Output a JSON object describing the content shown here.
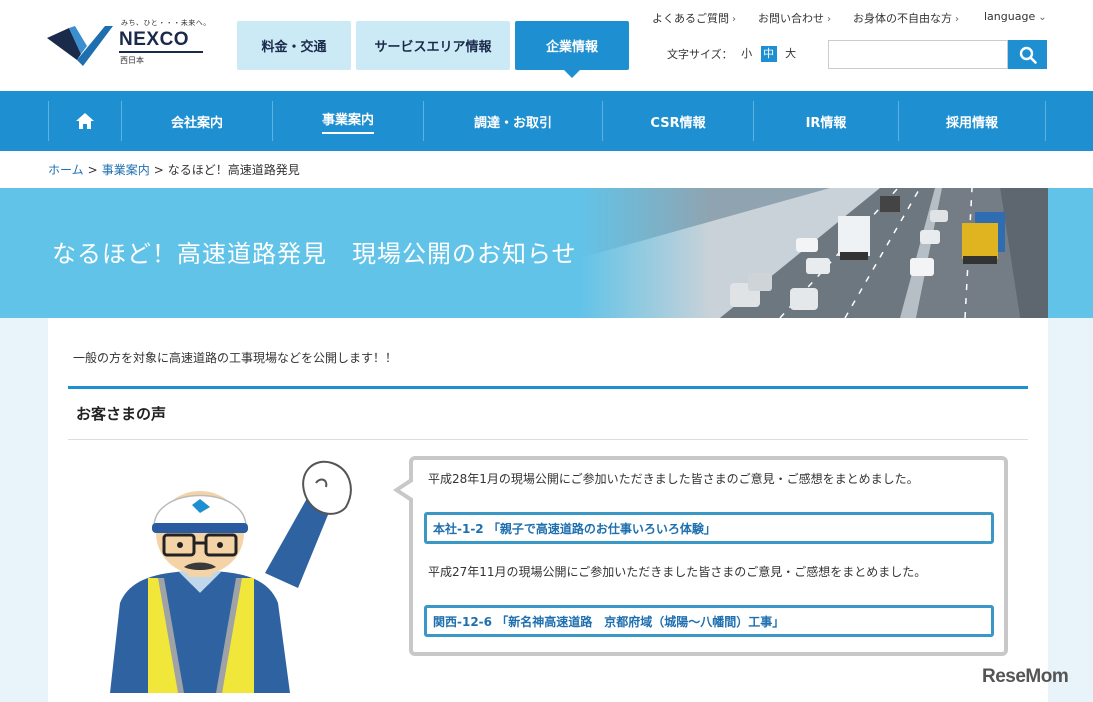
{
  "logo": {
    "tagline": "みち、ひと・・・未来へ。",
    "name": "NEXCO",
    "sub": "西日本"
  },
  "top_buttons": [
    {
      "label": "料金・交通"
    },
    {
      "label": "サービスエリア情報"
    },
    {
      "label": "企業情報"
    }
  ],
  "utility_links": [
    {
      "label": "よくあるご質問"
    },
    {
      "label": "お問い合わせ"
    },
    {
      "label": "お身体の不自由な方"
    },
    {
      "label": "language"
    }
  ],
  "font_size": {
    "label": "文字サイズ：",
    "options": [
      "小",
      "中",
      "大"
    ],
    "selected": "中"
  },
  "search": {
    "placeholder": ""
  },
  "nav": [
    {
      "label": "会社案内"
    },
    {
      "label": "事業案内"
    },
    {
      "label": "調達・お取引"
    },
    {
      "label": "CSR情報"
    },
    {
      "label": "IR情報"
    },
    {
      "label": "採用情報"
    }
  ],
  "breadcrumb": [
    {
      "label": "ホーム"
    },
    {
      "label": "事業案内"
    },
    {
      "label": "なるほど！高速道路発見"
    }
  ],
  "breadcrumb_sep": ">",
  "hero": {
    "title": "なるほど！高速道路発見　現場公開のお知らせ"
  },
  "intro": "一般の方を対象に高速道路の工事現場などを公開します！！",
  "section": {
    "title": "お客さまの声"
  },
  "voices": [
    {
      "text": "平成28年1月の現場公開にご参加いただきました皆さまのご意見・ご感想をまとめました。",
      "link": "本社-1-2 「親子で高速道路のお仕事いろいろ体験」"
    },
    {
      "text": "平成27年11月の現場公開にご参加いただきました皆さまのご意見・ご感想をまとめました。",
      "link": "関西-12-6 「新名神高速道路　京都府域（城陽～八幡間）工事」"
    }
  ],
  "watermark": "ReseMom",
  "colors": {
    "brand_blue": "#1e8fd0",
    "light_blue": "#cce9f6",
    "hero_blue": "#62c3e8"
  }
}
